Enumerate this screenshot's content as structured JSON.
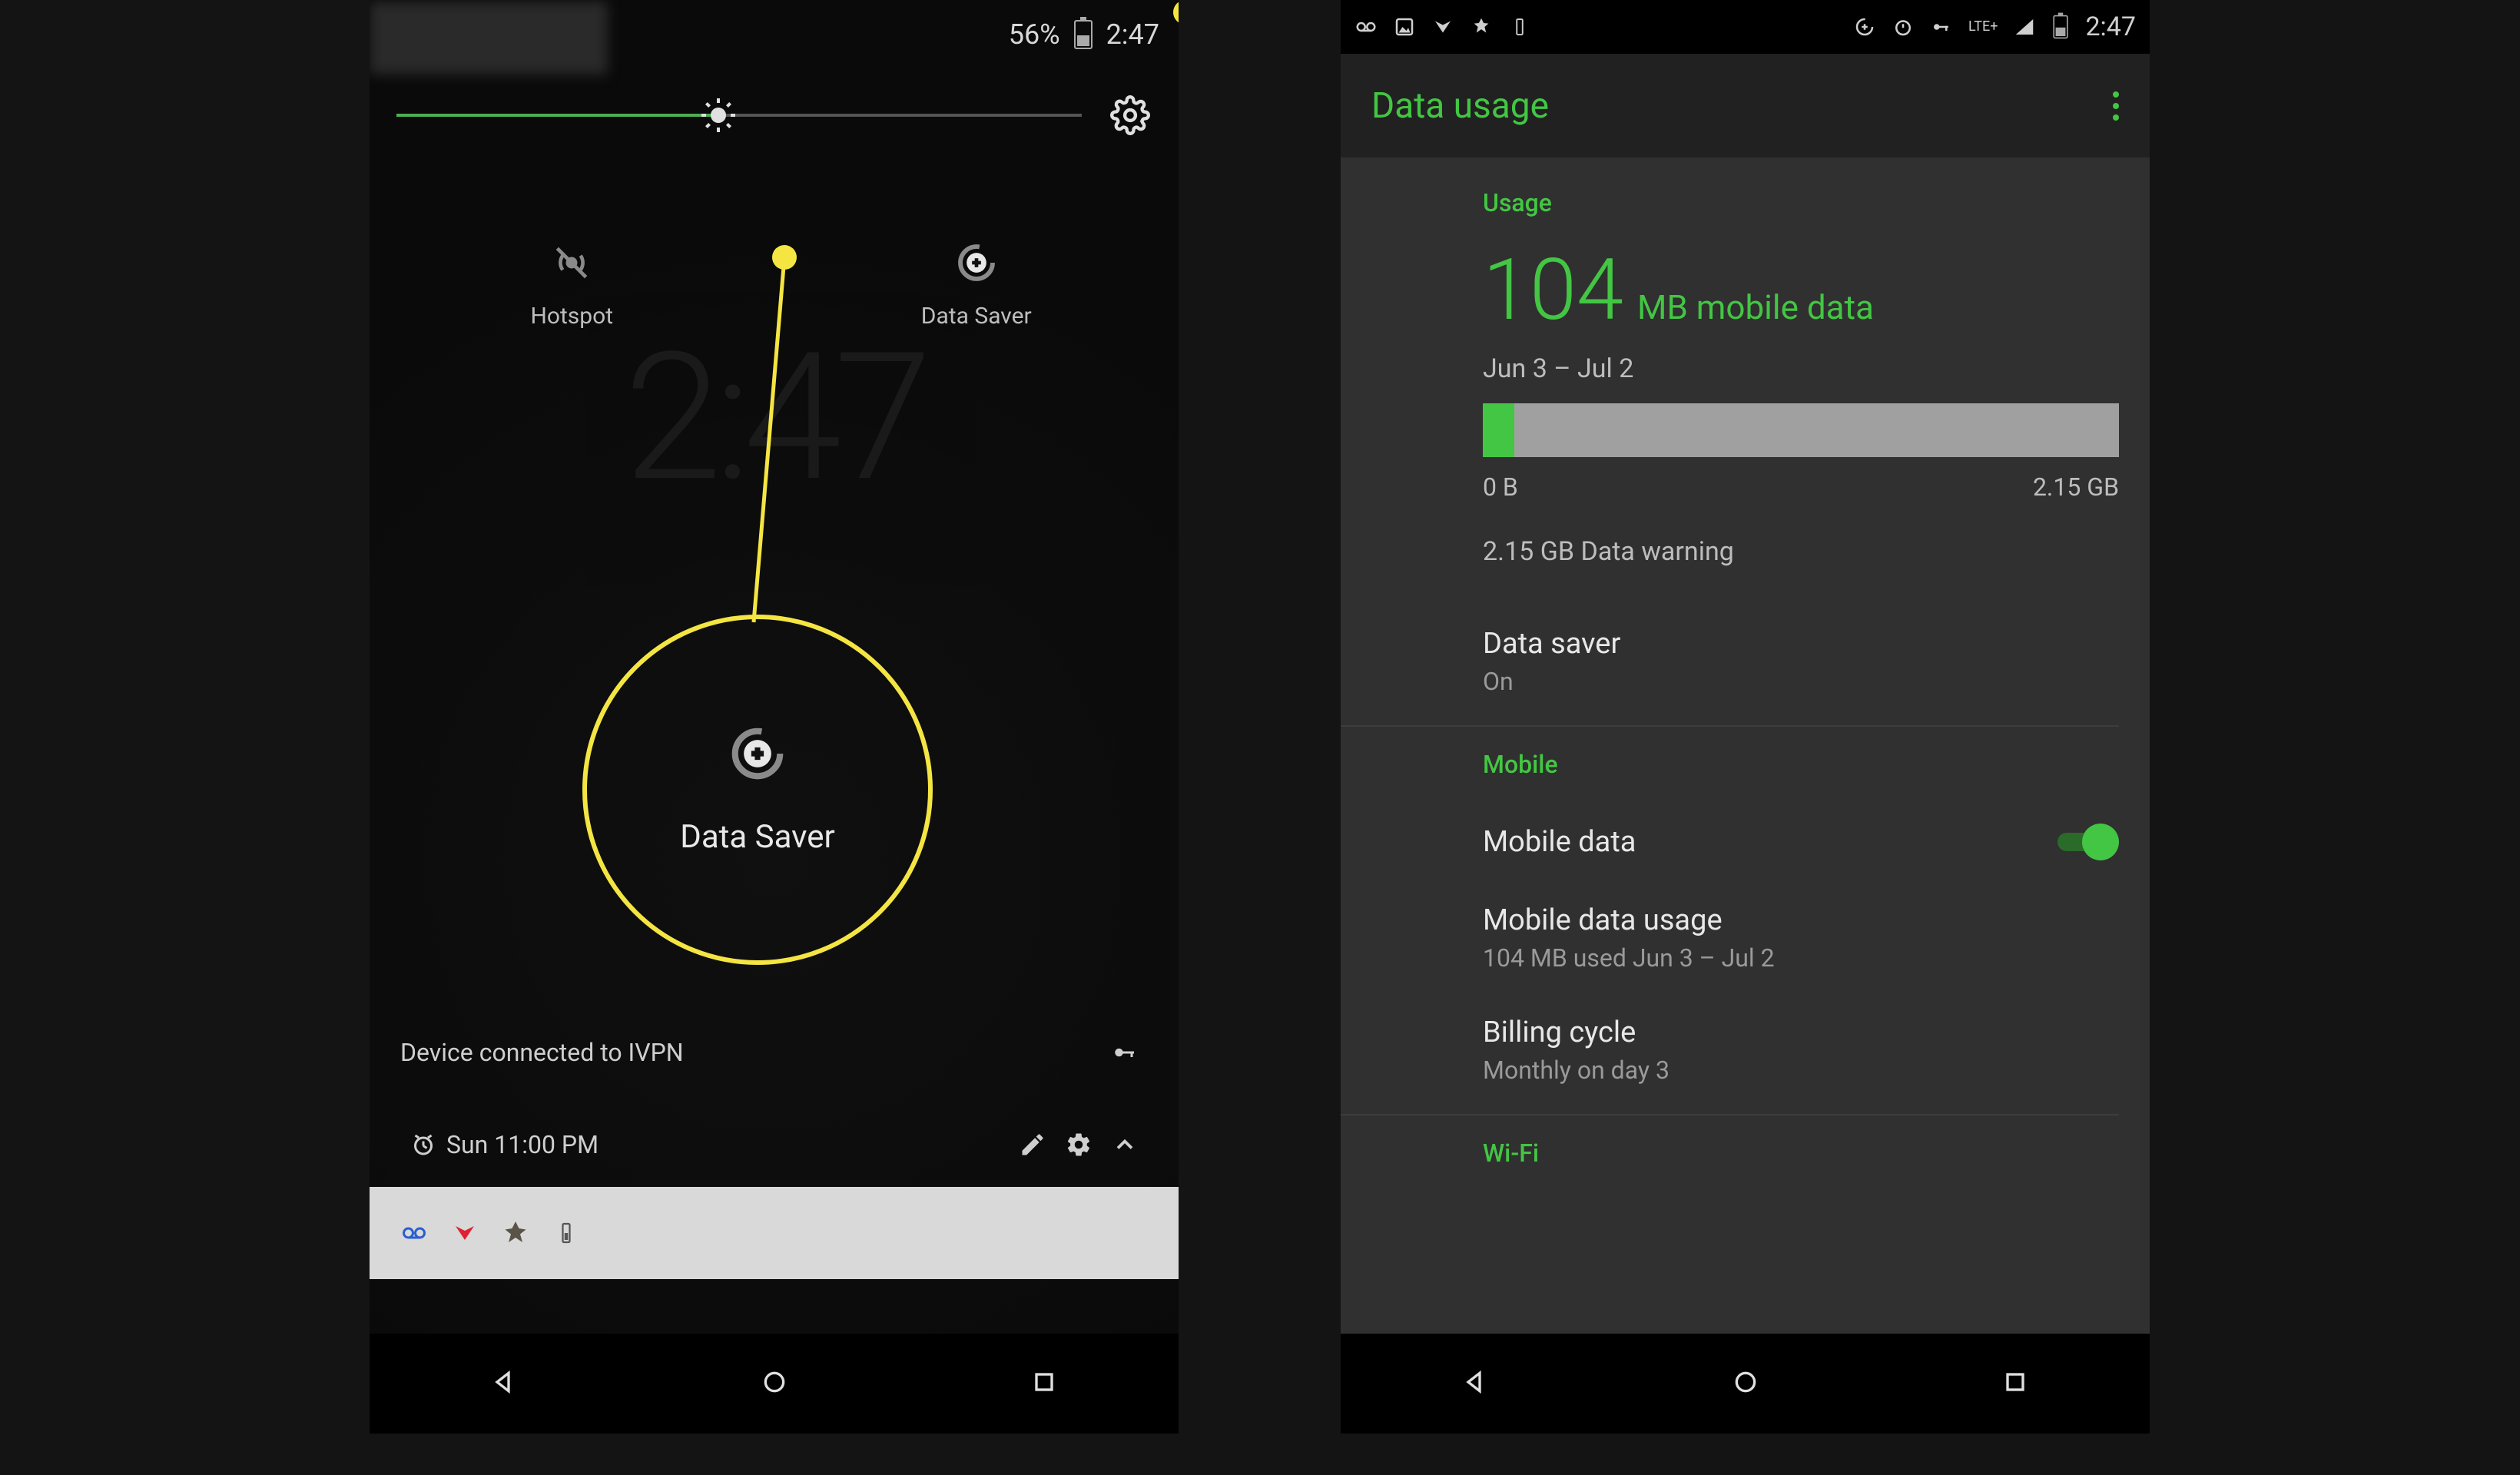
{
  "accent": "#43c643",
  "highlight": "#f4e542",
  "left": {
    "status": {
      "battery": "56%",
      "time": "2:47"
    },
    "brightness_percent": 47,
    "tiles": {
      "hotspot": {
        "label": "Hotspot"
      },
      "datasaver": {
        "label": "Data Saver"
      }
    },
    "callout": {
      "label": "Data Saver"
    },
    "vpn_notif": "Device connected to IVPN",
    "alarm_notif": "Sun 11:00 PM"
  },
  "right": {
    "status": {
      "time": "2:47",
      "network": "LTE+"
    },
    "appbar_title": "Data usage",
    "usage": {
      "header": "Usage",
      "amount": "104",
      "unit": "MB mobile data",
      "period": "Jun 3 – Jul 2",
      "bar_percent": 5,
      "min_label": "0 B",
      "max_label": "2.15 GB",
      "warning": "2.15 GB Data warning",
      "datasaver_title": "Data saver",
      "datasaver_state": "On"
    },
    "mobile": {
      "header": "Mobile",
      "mobile_data_label": "Mobile data",
      "mobile_data_on": true,
      "usage_title": "Mobile data usage",
      "usage_sub": "104 MB used Jun 3 – Jul 2",
      "billing_title": "Billing cycle",
      "billing_sub": "Monthly on day 3"
    },
    "wifi": {
      "header": "Wi-Fi"
    }
  }
}
